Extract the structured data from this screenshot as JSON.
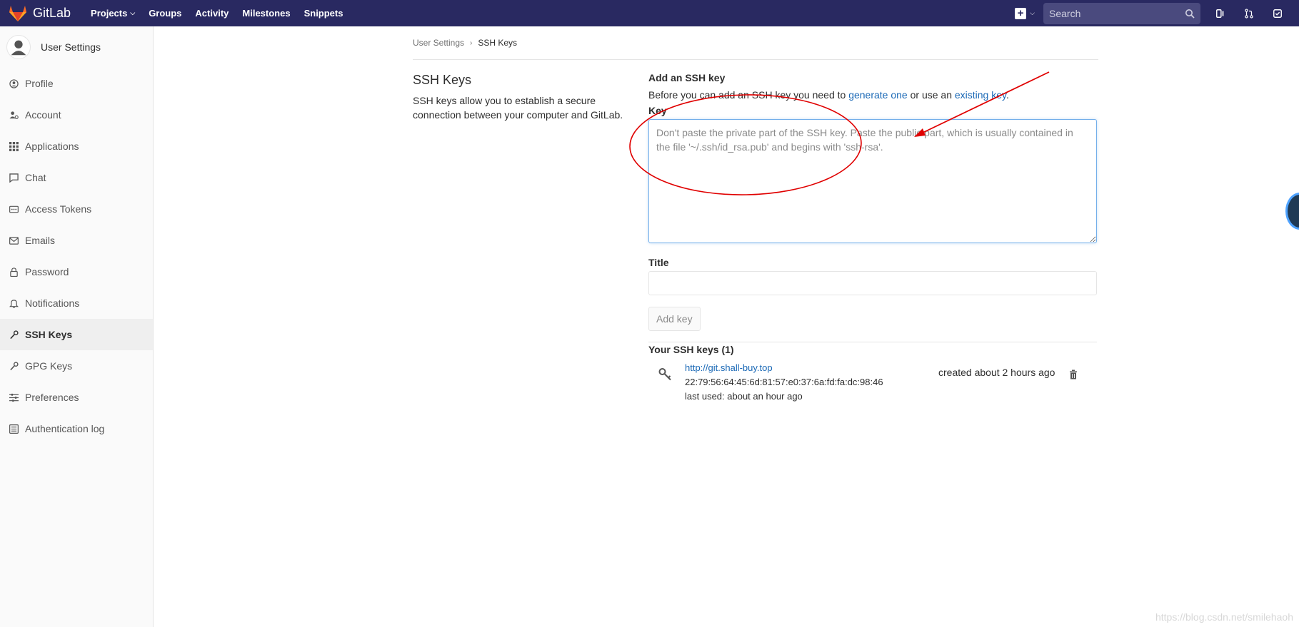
{
  "navbar": {
    "brand": "GitLab",
    "links": [
      {
        "label": "Projects",
        "has_dropdown": true
      },
      {
        "label": "Groups",
        "has_dropdown": false
      },
      {
        "label": "Activity",
        "has_dropdown": false
      },
      {
        "label": "Milestones",
        "has_dropdown": false
      },
      {
        "label": "Snippets",
        "has_dropdown": false
      }
    ],
    "search_placeholder": "Search"
  },
  "sidebar": {
    "title": "User Settings",
    "items": [
      {
        "label": "Profile",
        "icon": "profile-icon"
      },
      {
        "label": "Account",
        "icon": "account-icon"
      },
      {
        "label": "Applications",
        "icon": "applications-icon"
      },
      {
        "label": "Chat",
        "icon": "chat-icon"
      },
      {
        "label": "Access Tokens",
        "icon": "access-tokens-icon"
      },
      {
        "label": "Emails",
        "icon": "emails-icon"
      },
      {
        "label": "Password",
        "icon": "lock-icon"
      },
      {
        "label": "Notifications",
        "icon": "bell-icon"
      },
      {
        "label": "SSH Keys",
        "icon": "key-icon",
        "active": true
      },
      {
        "label": "GPG Keys",
        "icon": "key-icon"
      },
      {
        "label": "Preferences",
        "icon": "preferences-icon"
      },
      {
        "label": "Authentication log",
        "icon": "list-icon"
      }
    ]
  },
  "breadcrumb": {
    "parent": "User Settings",
    "current": "SSH Keys"
  },
  "section": {
    "title": "SSH Keys",
    "description": "SSH keys allow you to establish a secure connection between your computer and GitLab."
  },
  "form": {
    "heading": "Add an SSH key",
    "intro_prefix": "Before you can add an SSH key you need to ",
    "intro_link1": "generate one",
    "intro_middle": " or use an ",
    "intro_link2": "existing key",
    "intro_suffix": ".",
    "key_label": "Key",
    "key_placeholder": "Don't paste the private part of the SSH key. Paste the public part, which is usually contained in the file '~/.ssh/id_rsa.pub' and begins with 'ssh-rsa'.",
    "title_label": "Title",
    "title_value": "",
    "add_button": "Add key"
  },
  "keys": {
    "heading": "Your SSH keys (1)",
    "items": [
      {
        "title": "http://git.shall-buy.top",
        "fingerprint": "22:79:56:64:45:6d:81:57:e0:37:6a:fd:fa:dc:98:46",
        "last_used": "last used: about an hour ago",
        "created": "created about 2 hours ago"
      }
    ]
  },
  "watermark": "https://blog.csdn.net/smilehaoh",
  "colors": {
    "navbar": "#292961",
    "link": "#1b69b6",
    "annotation": "#e00000"
  }
}
